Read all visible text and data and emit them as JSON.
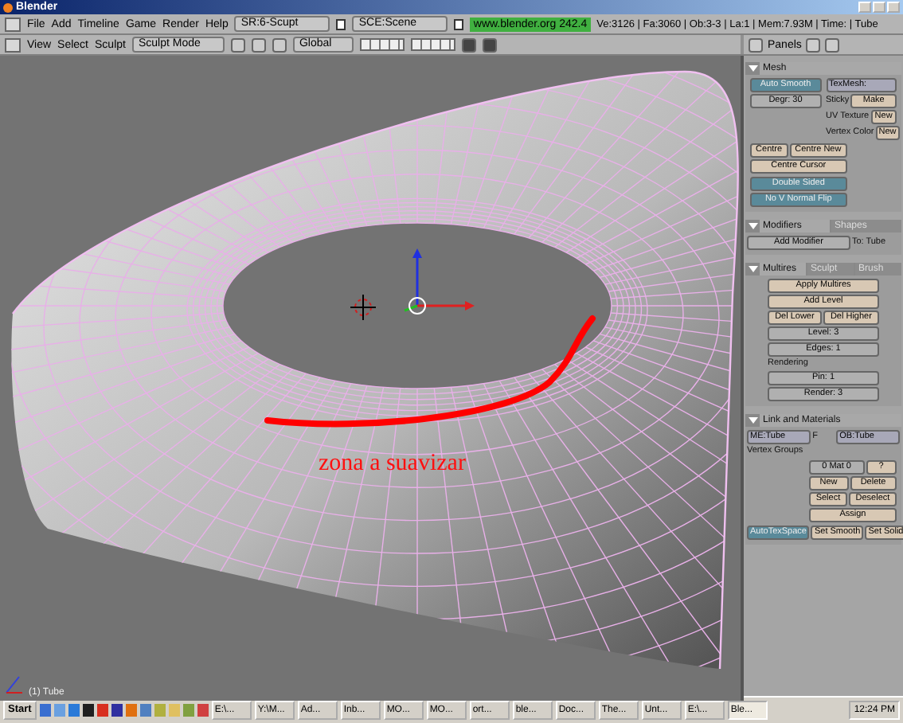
{
  "window": {
    "title": "Blender"
  },
  "menu_bar": {
    "items": [
      "File",
      "Add",
      "Timeline",
      "Game",
      "Render",
      "Help"
    ],
    "screen": "SR:6-Scupt",
    "scene": "SCE:Scene",
    "url": "www.blender.org 242.4",
    "stats": "Ve:3126 | Fa:3060 | Ob:3-3 | La:1 | Mem:7.93M | Time: | Tube"
  },
  "view_header": {
    "menus": [
      "View",
      "Select",
      "Sculpt"
    ],
    "mode": "Sculpt Mode",
    "orientation": "Global"
  },
  "buttons_header": {
    "label": "Panels"
  },
  "viewport": {
    "annotation": "zona a suavizar",
    "object_label": "(1) Tube"
  },
  "panels": [
    {
      "title": "Mesh",
      "blocks": [
        {
          "kind": "split",
          "columns": [
            [
              [
                {
                  "kind": "toggle",
                  "label": "Auto Smooth",
                  "on": true
                }
              ],
              [
                {
                  "kind": "num",
                  "label": "Degr: 30"
                }
              ]
            ],
            [
              [
                {
                  "kind": "field",
                  "label": "TexMesh:"
                }
              ],
              [
                {
                  "kind": "label",
                  "label": "Sticky"
                },
                {
                  "kind": "button",
                  "label": "Make"
                }
              ],
              [
                {
                  "kind": "label",
                  "label": "UV Texture"
                },
                {
                  "kind": "button",
                  "label": "New"
                }
              ],
              [
                {
                  "kind": "label",
                  "label": "Vertex Color"
                },
                {
                  "kind": "button",
                  "label": "New"
                }
              ]
            ]
          ]
        },
        {
          "kind": "left",
          "columns": [
            [
              [
                {
                  "kind": "button",
                  "label": "Centre"
                },
                {
                  "kind": "button",
                  "label": "Centre New"
                }
              ],
              [
                {
                  "kind": "button",
                  "label": "Centre Cursor"
                }
              ]
            ]
          ]
        },
        {
          "kind": "left",
          "columns": [
            [
              [
                {
                  "kind": "toggle",
                  "label": "Double Sided",
                  "on": true
                }
              ],
              [
                {
                  "kind": "toggle",
                  "label": "No V Normal Flip",
                  "on": true
                }
              ]
            ]
          ]
        }
      ]
    },
    {
      "title": "Modifiers",
      "tabs": [
        {
          "label": "Shapes",
          "selected": false
        }
      ],
      "blocks": [
        {
          "kind": "full",
          "columns": [
            [
              [
                {
                  "kind": "menu",
                  "label": "Add Modifier"
                },
                {
                  "kind": "label",
                  "label": "To: Tube"
                }
              ]
            ]
          ]
        }
      ]
    },
    {
      "title": "Multires",
      "tabs": [
        {
          "label": "Sculpt",
          "selected": false
        },
        {
          "label": "Brush",
          "selected": false
        }
      ],
      "blocks": [
        {
          "kind": "center",
          "columns": [
            [
              [
                {
                  "kind": "button",
                  "label": "Apply Multires"
                }
              ],
              [
                {
                  "kind": "button",
                  "label": "Add Level"
                }
              ],
              [
                {
                  "kind": "button",
                  "label": "Del Lower"
                },
                {
                  "kind": "button",
                  "label": "Del Higher"
                }
              ],
              [
                {
                  "kind": "num",
                  "label": "Level: 3"
                }
              ],
              [
                {
                  "kind": "num",
                  "label": "Edges: 1"
                }
              ],
              [
                {
                  "kind": "label",
                  "label": "Rendering"
                }
              ],
              [
                {
                  "kind": "num",
                  "label": "Pin: 1"
                }
              ],
              [
                {
                  "kind": "num",
                  "label": "Render: 3"
                }
              ]
            ]
          ]
        }
      ]
    },
    {
      "title": "Link and Materials",
      "blocks": [
        {
          "kind": "full",
          "columns": [
            [
              [
                {
                  "kind": "field",
                  "label": "ME:Tube"
                },
                {
                  "kind": "label",
                  "label": "F"
                },
                {
                  "kind": "field",
                  "label": "OB:Tube"
                }
              ],
              [
                {
                  "kind": "label",
                  "label": "Vertex Groups"
                }
              ]
            ]
          ]
        },
        {
          "kind": "right",
          "columns": [
            [
              [
                {
                  "kind": "num",
                  "label": "0 Mat 0"
                },
                {
                  "kind": "button",
                  "label": "?"
                }
              ],
              [
                {
                  "kind": "button",
                  "label": "New"
                },
                {
                  "kind": "button",
                  "label": "Delete"
                }
              ],
              [
                {
                  "kind": "button",
                  "label": "Select"
                },
                {
                  "kind": "button",
                  "label": "Deselect"
                }
              ],
              [
                {
                  "kind": "button",
                  "label": "Assign"
                }
              ]
            ]
          ]
        },
        {
          "kind": "full",
          "columns": [
            [
              [
                {
                  "kind": "toggle",
                  "label": "AutoTexSpace",
                  "on": true
                },
                {
                  "kind": "button",
                  "label": "Set Smooth"
                },
                {
                  "kind": "button",
                  "label": "Set Solid"
                }
              ]
            ]
          ]
        }
      ]
    }
  ],
  "taskbar": {
    "start": "Start",
    "tasks": [
      {
        "label": "E:\\...",
        "selected": false
      },
      {
        "label": "Y:\\M...",
        "selected": false
      },
      {
        "label": "Ad...",
        "selected": false
      },
      {
        "label": "Inb...",
        "selected": false
      },
      {
        "label": "MO...",
        "selected": false
      },
      {
        "label": "MO...",
        "selected": false
      },
      {
        "label": "ort...",
        "selected": false
      },
      {
        "label": "ble...",
        "selected": false
      },
      {
        "label": "Doc...",
        "selected": false
      },
      {
        "label": "The...",
        "selected": false
      },
      {
        "label": "Unt...",
        "selected": false
      },
      {
        "label": "E:\\...",
        "selected": false
      },
      {
        "label": "Ble...",
        "selected": true
      }
    ],
    "clock": "12:24 PM"
  }
}
